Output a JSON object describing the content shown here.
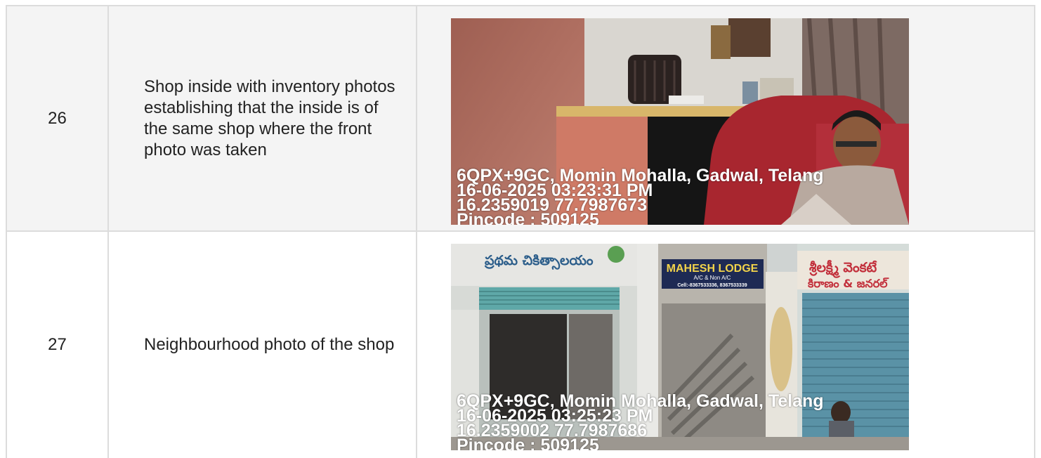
{
  "rows": [
    {
      "number": "26",
      "description": "Shop inside with inventory photos establishing that the inside is of the same shop where the front photo was taken",
      "photo": {
        "scene": "shop-interior",
        "overlay": [
          "6QPX+9GC, Momin Mohalla, Gadwal, Telang",
          "16-06-2025 03:23:31 PM",
          "16.2359019 77.7987673",
          "Pincode : 509125"
        ]
      }
    },
    {
      "number": "27",
      "description": "Neighbourhood photo of the shop",
      "photo": {
        "scene": "street-neighbourhood",
        "signs": {
          "clinic": "ప్రథమ చికిత్సాలయం",
          "lodge_name": "MAHESH LODGE",
          "lodge_sub": "A/C & Non A/C",
          "lodge_phone": "Cell:-8367533336, 8367533339",
          "shop_right": "శ్రీలక్ష్మీ వెంకటే",
          "shop_right_sub": "కిరాణం & జనరల్"
        },
        "overlay": [
          "6QPX+9GC, Momin Mohalla, Gadwal, Telang",
          "16-06-2025 03:25:23 PM",
          "16.2359002 77.7987686",
          "Pincode : 509125"
        ]
      }
    }
  ]
}
